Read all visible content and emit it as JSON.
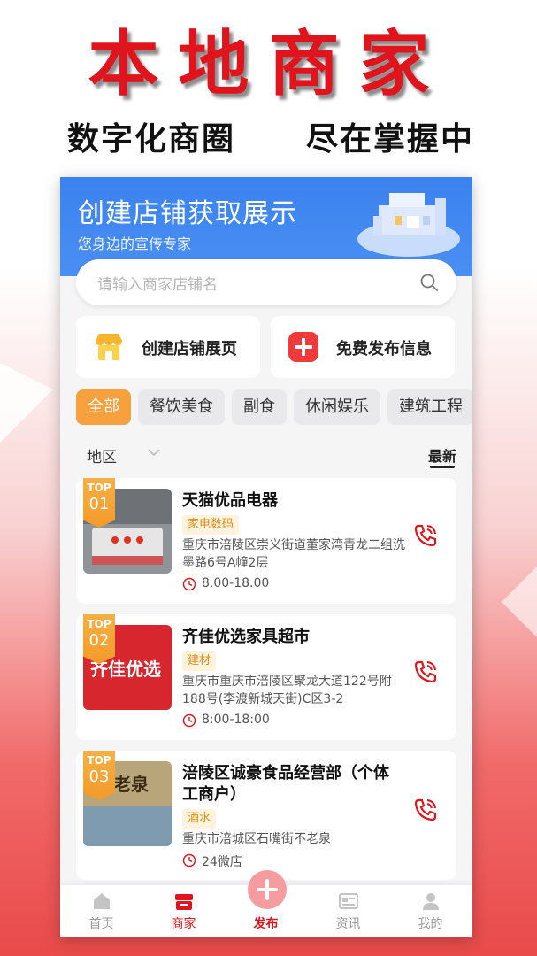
{
  "promo": {
    "headline": "本地商家",
    "tagline_left": "数字化商圈",
    "tagline_right": "尽在掌握中"
  },
  "banner": {
    "title": "创建店铺获取展示",
    "subtitle": "您身边的宣传专家"
  },
  "search": {
    "placeholder": "请输入商家店铺名"
  },
  "actions": [
    {
      "label": "创建店铺展页",
      "icon": "shop-icon"
    },
    {
      "label": "免费发布信息",
      "icon": "plus-icon"
    }
  ],
  "categories": [
    "全部",
    "餐饮美食",
    "副食",
    "休闲娱乐",
    "建筑工程"
  ],
  "filters": {
    "region": "地区",
    "sort": "最新"
  },
  "stores": [
    {
      "rank_label": "TOP",
      "rank": "01",
      "name": "天猫优品电器",
      "tag": "家电数码",
      "address": "重庆市涪陵区崇义街道董家湾青龙二组洗墨路6号A幢2层",
      "hours": "8.00-18.00"
    },
    {
      "rank_label": "TOP",
      "rank": "02",
      "name": "齐佳优选家具超市",
      "tag": "建材",
      "address": "重庆市重庆市涪陵区聚龙大道122号附188号(李渡新城天街)C区3-2",
      "hours": "8:00-18:00",
      "thumb_text": "齐佳优选"
    },
    {
      "rank_label": "TOP",
      "rank": "03",
      "name": "涪陵区诚豪食品经营部（个体工商户）",
      "tag": "酒水",
      "address": "重庆市涪城区石嘴街不老泉",
      "hours": "24微店",
      "thumb_text": "老泉"
    }
  ],
  "tabbar": [
    {
      "label": "首页",
      "icon": "home-icon"
    },
    {
      "label": "商家",
      "icon": "store-icon"
    },
    {
      "label": "发布",
      "icon": "plus-circle-icon"
    },
    {
      "label": "资讯",
      "icon": "news-icon"
    },
    {
      "label": "我的",
      "icon": "user-icon"
    }
  ],
  "colors": {
    "brand_red": "#e0141c",
    "banner_blue": "#3b82f0",
    "accent_orange": "#f7a03e"
  }
}
